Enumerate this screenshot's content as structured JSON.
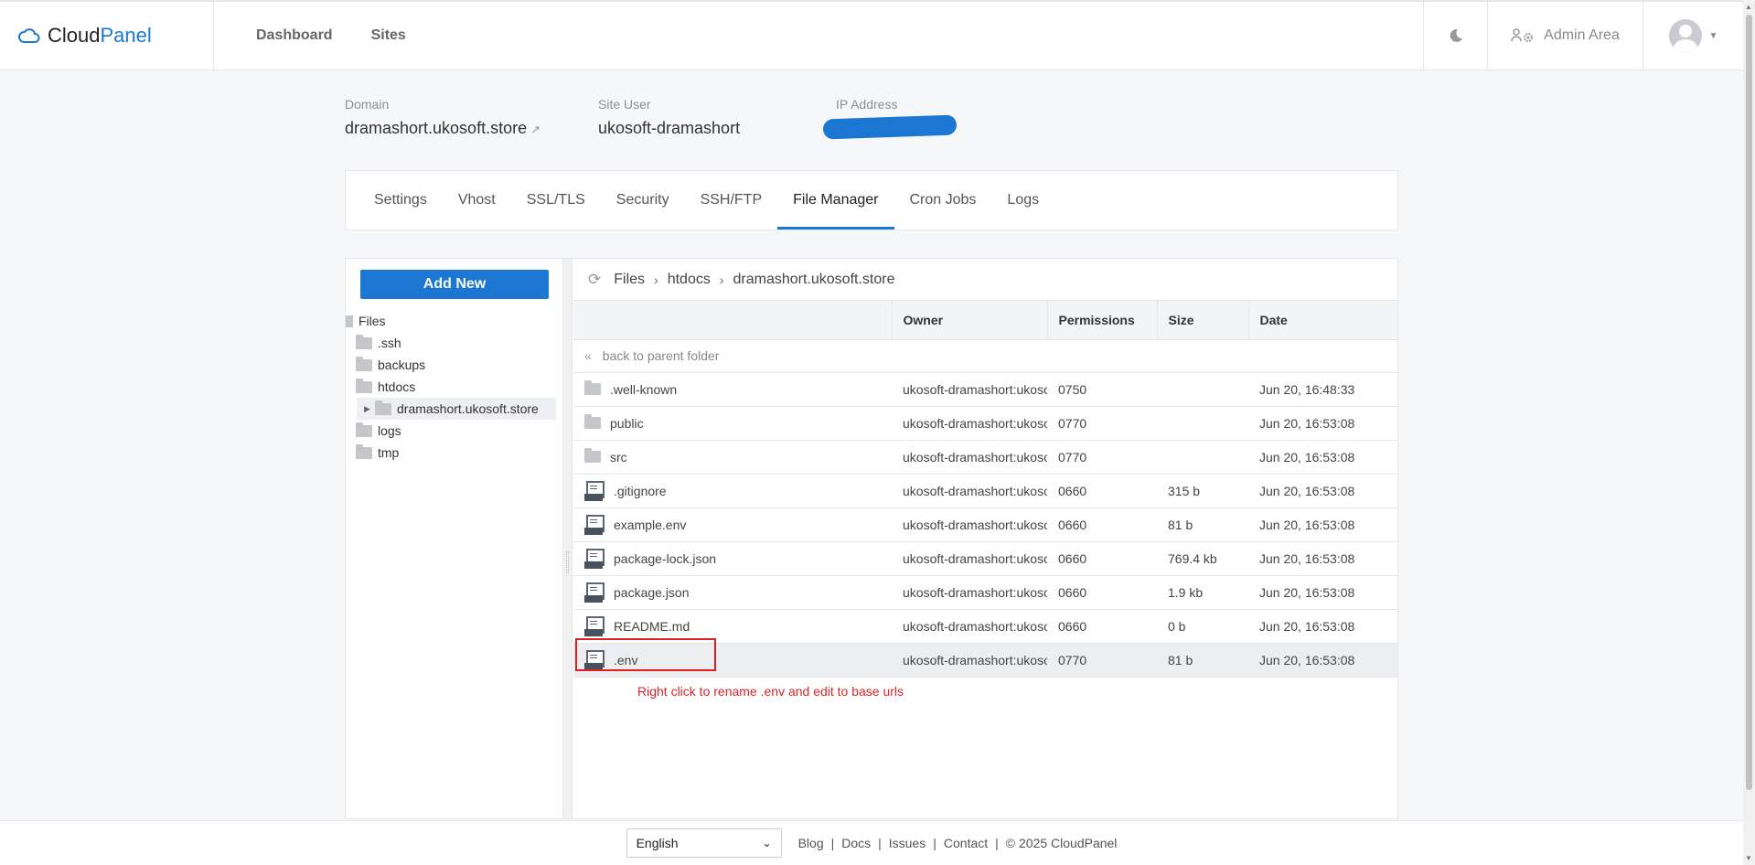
{
  "header": {
    "logo_prefix": "Cloud",
    "logo_accent": "Panel",
    "nav": [
      "Dashboard",
      "Sites"
    ],
    "admin_label": "Admin Area"
  },
  "site": {
    "domain_label": "Domain",
    "domain_value": "dramashort.ukosoft.store",
    "user_label": "Site User",
    "user_value": "ukosoft-dramashort",
    "ip_label": "IP Address"
  },
  "tabs": [
    "Settings",
    "Vhost",
    "SSL/TLS",
    "Security",
    "SSH/FTP",
    "File Manager",
    "Cron Jobs",
    "Logs"
  ],
  "active_tab": "File Manager",
  "file_manager": {
    "add_new": "Add New",
    "tree": {
      "root": "Files",
      "items": [
        ".ssh",
        "backups",
        "htdocs",
        "dramashort.ukosoft.store",
        "logs",
        "tmp"
      ]
    },
    "breadcrumb": [
      "Files",
      "htdocs",
      "dramashort.ukosoft.store"
    ],
    "columns": [
      "",
      "Owner",
      "Permissions",
      "Size",
      "Date"
    ],
    "parent_label": "back to parent folder",
    "rows": [
      {
        "name": ".well-known",
        "type": "folder",
        "owner": "ukosoft-dramashort:ukosoft",
        "perm": "0750",
        "size": "",
        "date": "Jun 20, 16:48:33"
      },
      {
        "name": "public",
        "type": "folder",
        "owner": "ukosoft-dramashort:ukosoft",
        "perm": "0770",
        "size": "",
        "date": "Jun 20, 16:53:08"
      },
      {
        "name": "src",
        "type": "folder",
        "owner": "ukosoft-dramashort:ukosoft",
        "perm": "0770",
        "size": "",
        "date": "Jun 20, 16:53:08"
      },
      {
        "name": ".gitignore",
        "type": "file",
        "owner": "ukosoft-dramashort:ukosoft",
        "perm": "0660",
        "size": "315 b",
        "date": "Jun 20, 16:53:08"
      },
      {
        "name": "example.env",
        "type": "file",
        "owner": "ukosoft-dramashort:ukosoft",
        "perm": "0660",
        "size": "81 b",
        "date": "Jun 20, 16:53:08"
      },
      {
        "name": "package-lock.json",
        "type": "file",
        "owner": "ukosoft-dramashort:ukosoft",
        "perm": "0660",
        "size": "769.4 kb",
        "date": "Jun 20, 16:53:08"
      },
      {
        "name": "package.json",
        "type": "file",
        "owner": "ukosoft-dramashort:ukosoft",
        "perm": "0660",
        "size": "1.9 kb",
        "date": "Jun 20, 16:53:08"
      },
      {
        "name": "README.md",
        "type": "file",
        "owner": "ukosoft-dramashort:ukosoft",
        "perm": "0660",
        "size": "0 b",
        "date": "Jun 20, 16:53:08"
      },
      {
        "name": ".env",
        "type": "file",
        "owner": "ukosoft-dramashort:ukosoft",
        "perm": "0770",
        "size": "81 b",
        "date": "Jun 20, 16:53:08"
      }
    ],
    "annotation": "Right click to rename .env and edit to base urls"
  },
  "footer": {
    "language": "English",
    "links": [
      "Blog",
      "Docs",
      "Issues",
      "Contact"
    ],
    "copyright": "© 2025  CloudPanel"
  },
  "colors": {
    "accent": "#1b77d2",
    "annotation": "#d7262a"
  }
}
